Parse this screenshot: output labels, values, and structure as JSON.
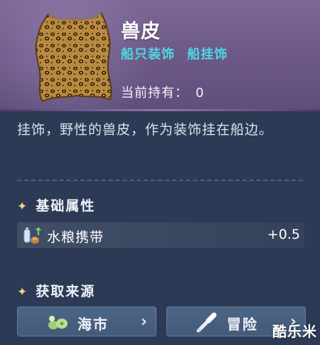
{
  "item": {
    "name": "兽皮",
    "tags": [
      "船只装饰",
      "船挂饰"
    ],
    "owned_label": "当前持有：",
    "owned_count": "0",
    "icon": "leopard-hide-icon"
  },
  "description": "挂饰，野性的兽皮，作为装饰挂在船边。",
  "attributes": {
    "title": "基础属性",
    "items": [
      {
        "icon": "water-food-icon",
        "name": "水粮携带",
        "value": "+0.5"
      }
    ]
  },
  "sources": {
    "title": "获取来源",
    "buttons": [
      {
        "icon": "market-icon",
        "label": "海市"
      },
      {
        "icon": "spyglass-icon",
        "label": "冒险"
      }
    ]
  },
  "watermark": "酷乐米",
  "colors": {
    "header": "#6e5a89",
    "tag": "#4fd6e0",
    "body": "#2c3a55",
    "star": "#f2d27c",
    "button": "#4d6685"
  }
}
